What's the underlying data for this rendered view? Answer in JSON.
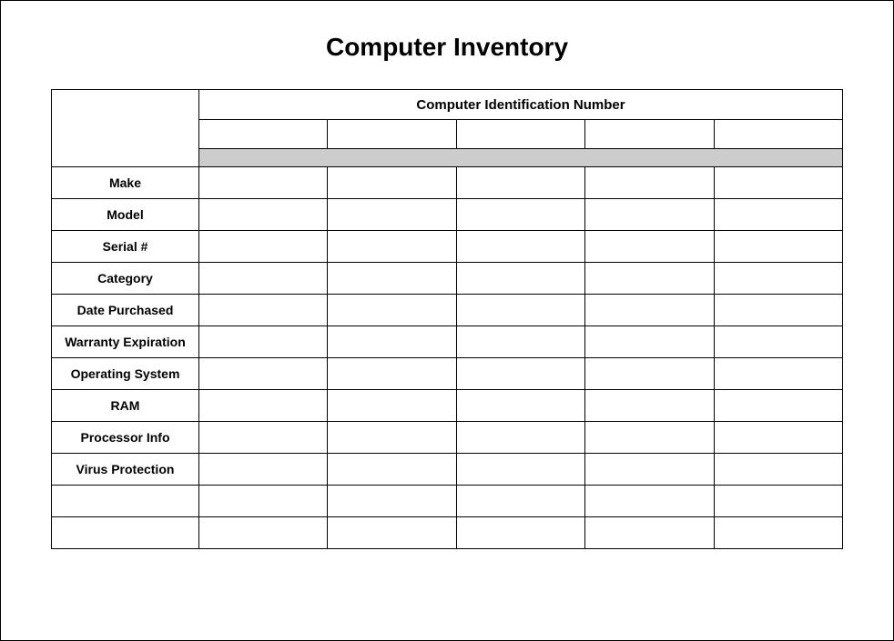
{
  "title": "Computer Inventory",
  "header": {
    "identification": "Computer Identification Number"
  },
  "row_labels": [
    "Make",
    "Model",
    "Serial #",
    "Category",
    "Date Purchased",
    "Warranty Expiration",
    "Operating System",
    "RAM",
    "Processor Info",
    "Virus Protection",
    "",
    ""
  ]
}
